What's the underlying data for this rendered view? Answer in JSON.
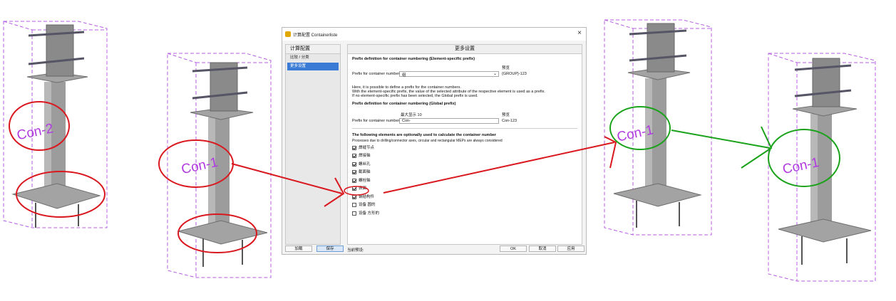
{
  "dialog": {
    "title": "计算配置 Containerliste",
    "sidebar": {
      "title": "计算配置",
      "items": [
        "比较 / 分类",
        "更多设置"
      ],
      "active_index": 1
    },
    "panel": {
      "title": "更多设置",
      "section1_title": "Prefix definition for container numbering (Element-specific  prefix)",
      "preview_label": "预览",
      "prefix_label": "Prefix for container number",
      "prefix_value": "组",
      "preview_value": "{GROUP}-123",
      "description": [
        "Here, it is possible to define a prefix for the container numbers.",
        "With the element-specific prefix, the value of the selected attribute of the respective element is used as a prefix.",
        "If no element-specific prefix has been selected, the Global prefix  is used."
      ],
      "section2_title": "Prefix definition for container numbering (Global prefix)",
      "maxlen_label": "最大显示 10",
      "preview2_label": "预览",
      "global_prefix_label": "Prefix for container number",
      "global_prefix_value": "Con-",
      "global_preview_value": "Con-123",
      "section3_title": "The following elements are optionally used to calculate the  container number",
      "section3_note": "Processes due to drilling/connector axes, circular and rectangular MEPs are always considered",
      "checkboxes": [
        {
          "label": "焊缝节点",
          "checked": true
        },
        {
          "label": "焊接轴",
          "checked": true
        },
        {
          "label": "螺丝孔",
          "checked": true
        },
        {
          "label": "截面轴",
          "checked": true
        },
        {
          "label": "螺栓轴",
          "checked": true
        },
        {
          "label": "表面",
          "checked": true
        },
        {
          "label": "钢结构件",
          "checked": true
        },
        {
          "label": "设备 圆的",
          "checked": false
        },
        {
          "label": "设备 方形的",
          "checked": false
        }
      ]
    },
    "footer": {
      "left_buttons": [
        "加载",
        "保存"
      ],
      "current_label": "当前预设:",
      "ok": "OK",
      "cancel": "取消",
      "apply": "应用"
    }
  },
  "annotations": {
    "labels": [
      "Con-2",
      "Con-1",
      "Con-1",
      "Con-1"
    ],
    "colors": {
      "red": "#d9181f",
      "green": "#1aa31a",
      "bbox": "#b45de0"
    }
  }
}
